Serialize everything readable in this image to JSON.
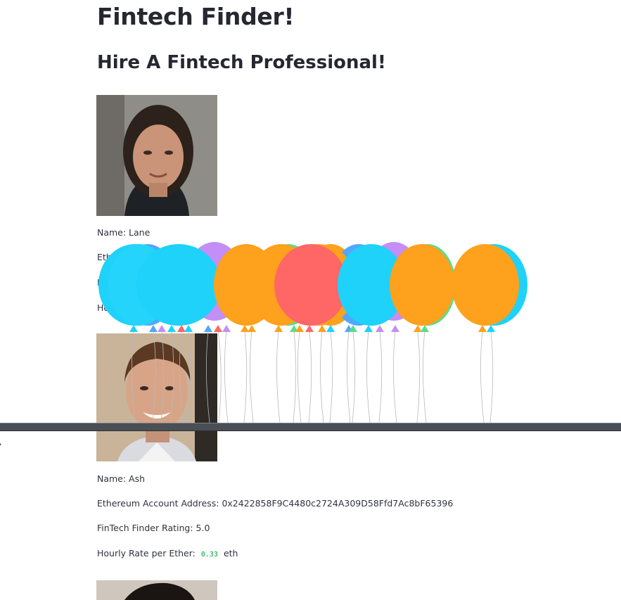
{
  "app": {
    "title": "Fintech Finder!",
    "subtitle": "Hire A Fintech Professional!"
  },
  "sidebar": {
    "expand_icon": "chevron-right-icon"
  },
  "professionals": [
    {
      "name_label": "Name: Lane",
      "address_label": "Ethereum Account Address:",
      "rating_label": "FinTech Finder Rating:",
      "rate_label": "Hourly Rate per Ether:"
    },
    {
      "name_label": "Name: Ash",
      "address_label": "Ethereum Account Address: 0x2422858F9C4480c2724A309D58Ffd7Ac8bF65396",
      "rating_label": "FinTech Finder Rating: 5.0",
      "rate_prefix": "Hourly Rate per Ether:",
      "rate_value": "0.33",
      "rate_unit": "eth"
    }
  ],
  "balloon_colors": [
    "#1ed2fa",
    "#4fa8fb",
    "#c38ef6",
    "#fea11c",
    "#ff6666",
    "#5bdc8c"
  ]
}
